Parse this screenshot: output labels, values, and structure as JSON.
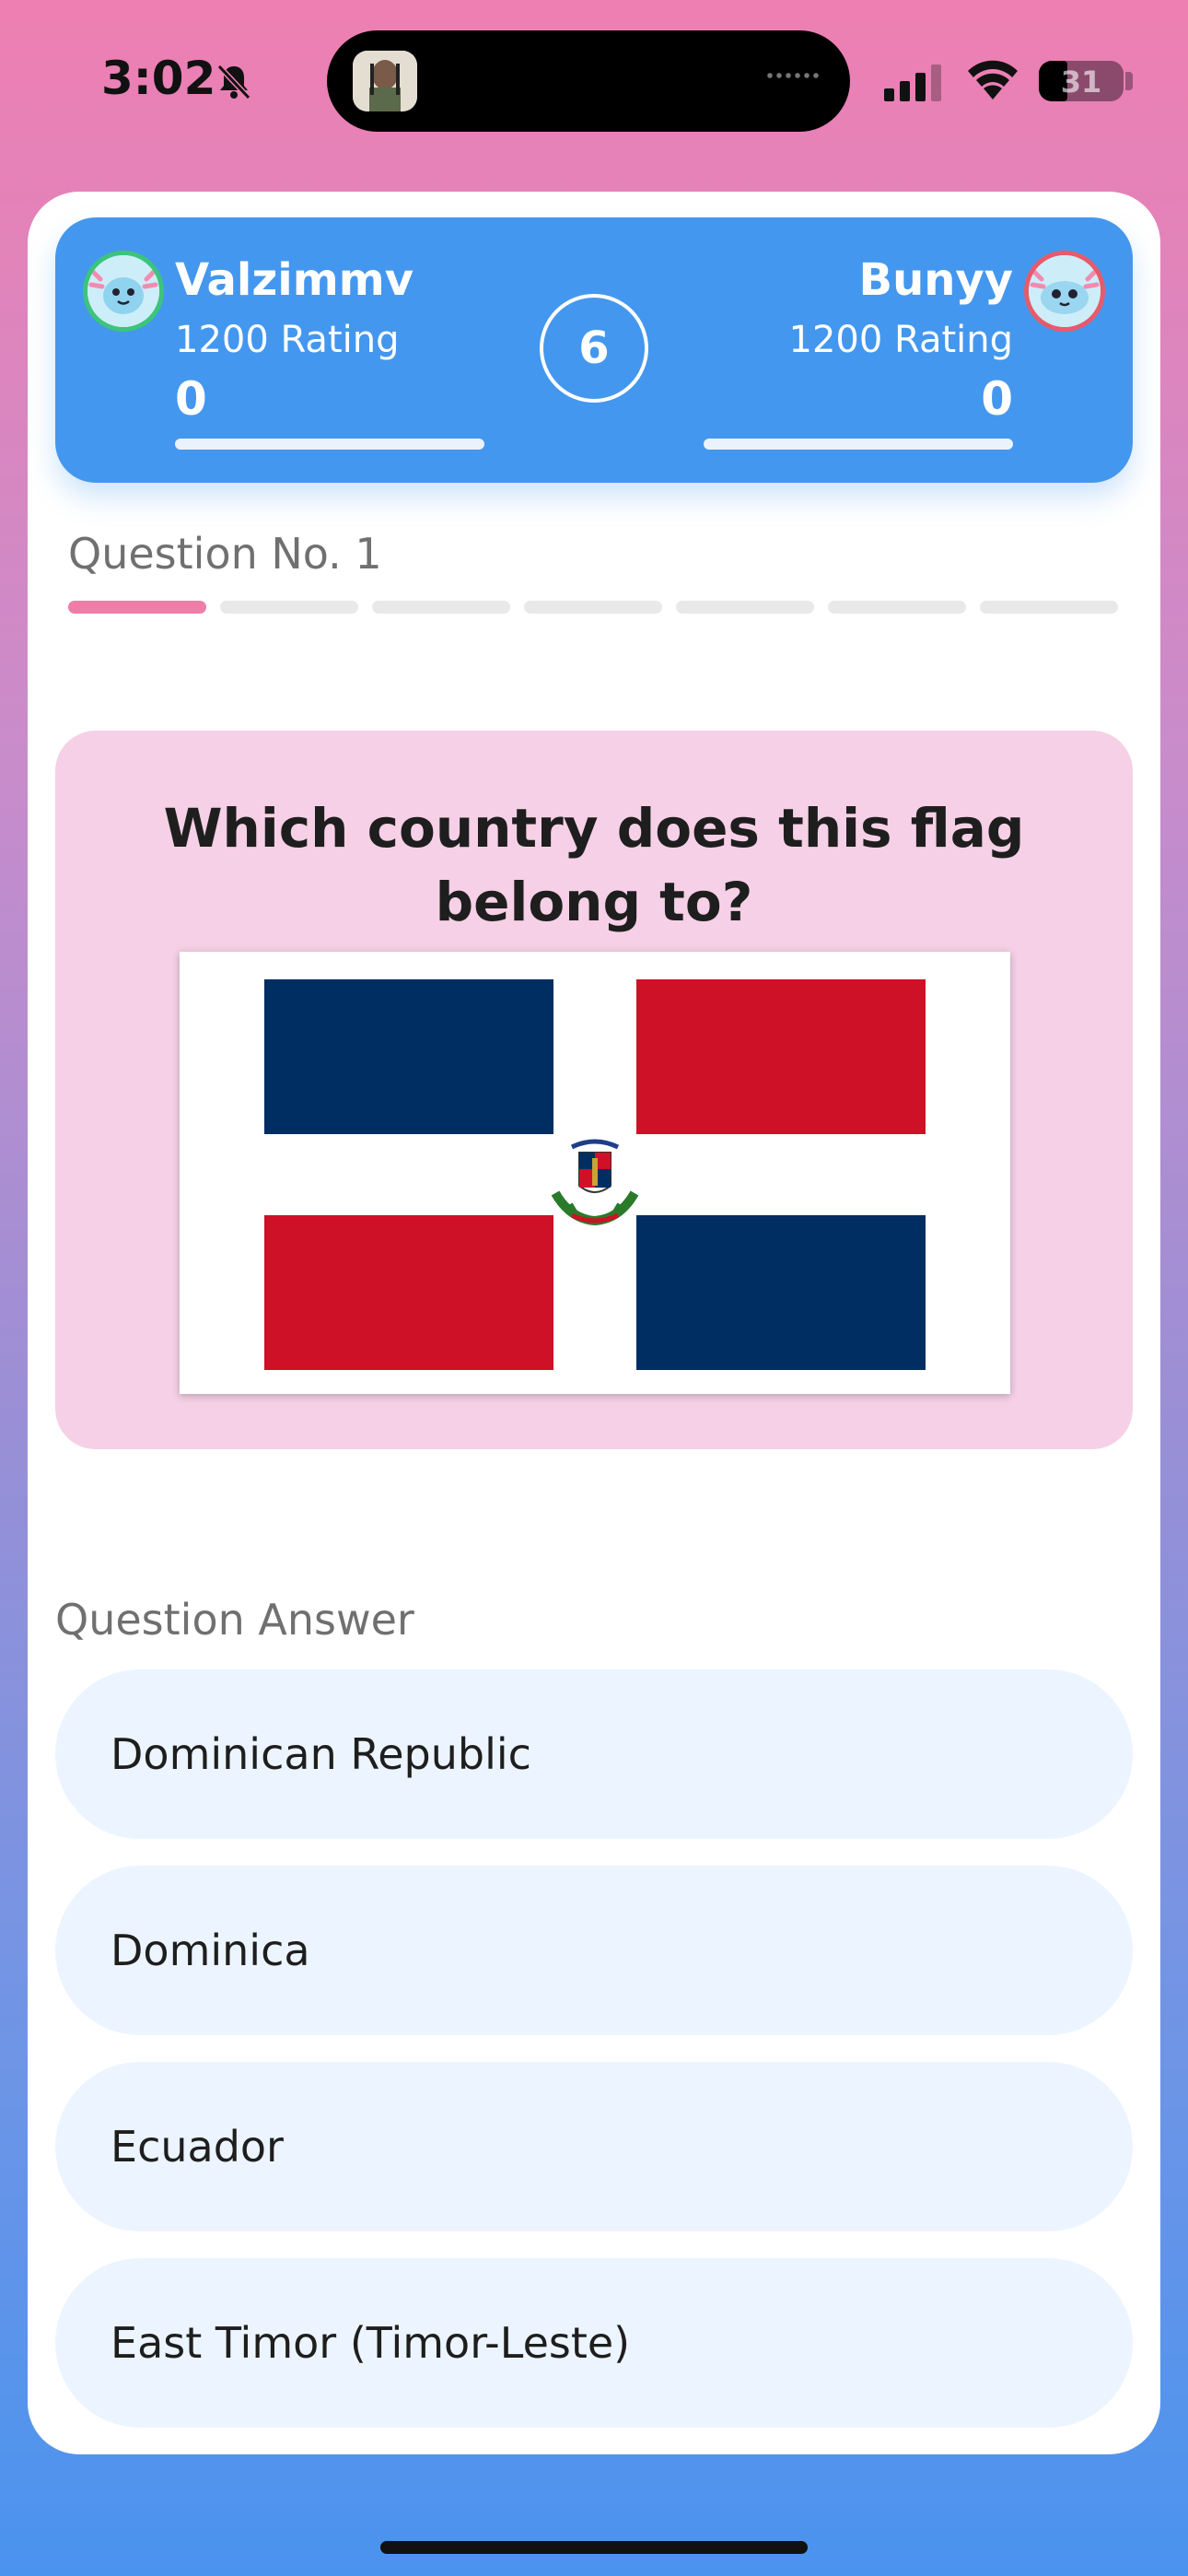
{
  "status_bar": {
    "time": "3:02",
    "battery": "31"
  },
  "players": {
    "left": {
      "name": "Valzimmv",
      "rating": "1200 Rating",
      "score": "0",
      "ring_color": "#3cc47a"
    },
    "right": {
      "name": "Bunyy",
      "rating": "1200 Rating",
      "score": "0",
      "ring_color": "#e85a6a"
    }
  },
  "timer": "6",
  "question": {
    "number_label": "Question No. 1",
    "total_segments": 7,
    "current": 1,
    "text": "Which country does this flag belong to?"
  },
  "answers_label": "Question Answer",
  "answers": [
    "Dominican Republic",
    "Dominica",
    "Ecuador",
    "East Timor (Timor-Leste)"
  ],
  "colors": {
    "accent_blue": "#4497ee",
    "accent_pink": "#ee7ea8",
    "flag_blue": "#002d62",
    "flag_red": "#ce1126",
    "answer_bg": "#ecf5ff"
  }
}
